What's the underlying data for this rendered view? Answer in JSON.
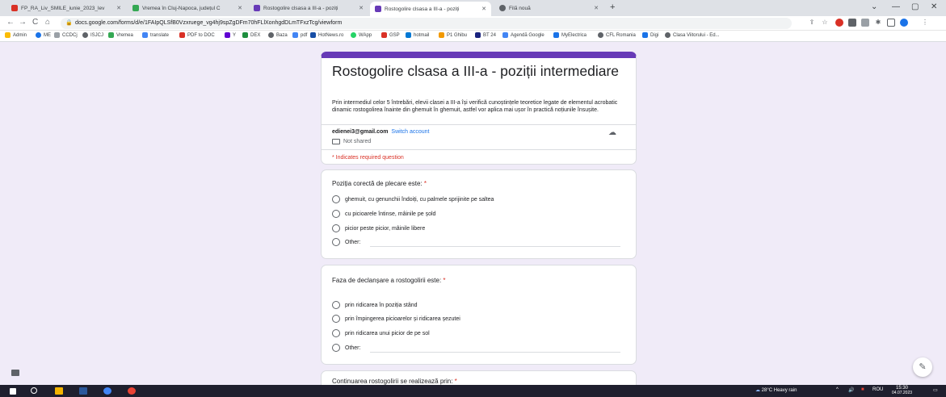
{
  "browser": {
    "tabs": [
      {
        "label": "FP_RA_Liv_SMILE_iunie_2023_lev",
        "favicon_color": "#d93025",
        "active": false
      },
      {
        "label": "Vremea în Cluj-Napoca, județul C",
        "favicon_color": "#34a853",
        "active": false
      },
      {
        "label": "Rostogolire clsasa a III-a - poziți",
        "favicon_color": "#673ab7",
        "active": false
      },
      {
        "label": "Rostogolire clsasa a III-a - poziți",
        "favicon_color": "#673ab7",
        "active": true
      },
      {
        "label": "Filă nouă",
        "favicon_color": "#5f6368",
        "active": false
      }
    ],
    "new_tab": "+",
    "window_controls": {
      "minimize": "—",
      "maximize": "▢",
      "close": "✕",
      "dropdown": "⌄"
    },
    "url": "docs.google.com/forms/d/e/1FAIpQLSfB0Vzxruege_vg4hj9spZgDFm70hFLlXonhgdDLmTFxzTcg/viewform",
    "nav": {
      "back": "←",
      "forward": "→",
      "reload": "C",
      "home": "⌂"
    },
    "bookmarks": [
      {
        "label": "Admin",
        "color": "#fbbc04"
      },
      {
        "label": "ME",
        "color": "#1a73e8"
      },
      {
        "label": "CCDCj",
        "color": "#9aa0a6"
      },
      {
        "label": "ISJCJ",
        "color": "#5f6368"
      },
      {
        "label": "Vremea",
        "color": "#34a853"
      },
      {
        "label": "translate",
        "color": "#4285f4"
      },
      {
        "label": "PDF to DOC",
        "color": "#d93025"
      },
      {
        "label": "Y",
        "color": "#6001d2"
      },
      {
        "label": "DEX",
        "color": "#1e8e3e"
      },
      {
        "label": "Baza",
        "color": "#5f6368"
      },
      {
        "label": "pdf",
        "color": "#4285f4"
      },
      {
        "label": "HotNews.ro",
        "color": "#174ea6"
      },
      {
        "label": "WApp",
        "color": "#25d366"
      },
      {
        "label": "GSP",
        "color": "#d93025"
      },
      {
        "label": "hotmail",
        "color": "#0078d4"
      },
      {
        "label": "P1 Ghibu",
        "color": "#f29900"
      },
      {
        "label": "BT 24",
        "color": "#1a237e"
      },
      {
        "label": "Agendă Google",
        "color": "#4285f4"
      },
      {
        "label": "MyElectrica",
        "color": "#1a73e8"
      },
      {
        "label": "CFL Romania",
        "color": "#5f6368"
      },
      {
        "label": "Digi",
        "color": "#1a73e8"
      },
      {
        "label": "Clasa Viitorului - Ed...",
        "color": "#5f6368"
      }
    ]
  },
  "form": {
    "title": "Rostogolire clsasa a III-a  - poziții intermediare",
    "description": "Prin intermediul celor 5 întrebări, elevii clasei a III-a își verifică cunoștințele teoretice legate de elementul acrobatic dinamic rostogolirea înainte din ghemuit în ghemuit, astfel vor aplica mai ușor în practică noțiunile însușite.",
    "account_email": "edienei3@gmail.com",
    "switch_account": "Switch account",
    "not_shared": "Not shared",
    "required_note": "* Indicates required question",
    "accent_color": "#673ab7",
    "questions": [
      {
        "title": "Poziția corectă de plecare este:",
        "required_mark": "*",
        "options": [
          "ghemuit, cu genunchii îndoiți, cu palmele sprijinite pe saltea",
          "cu picioarele întinse, mâinile pe șold",
          "picior peste picior, mâinile libere",
          "Other:"
        ]
      },
      {
        "title": "Faza de declanșare a rostogolirii este:",
        "required_mark": "*",
        "options": [
          "prin ridicarea în poziția stând",
          "prin împingerea picioarelor și ridicarea șezutei",
          "prin ridicarea unui picior de pe sol",
          "Other:"
        ]
      },
      {
        "title": "Continuarea rostogolirii se realizează prin:",
        "required_mark": "*",
        "options": []
      }
    ]
  },
  "taskbar": {
    "weather": "28°C  Heavy rain",
    "language": "ROU",
    "time": "15:30",
    "date": "04.07.2023"
  }
}
